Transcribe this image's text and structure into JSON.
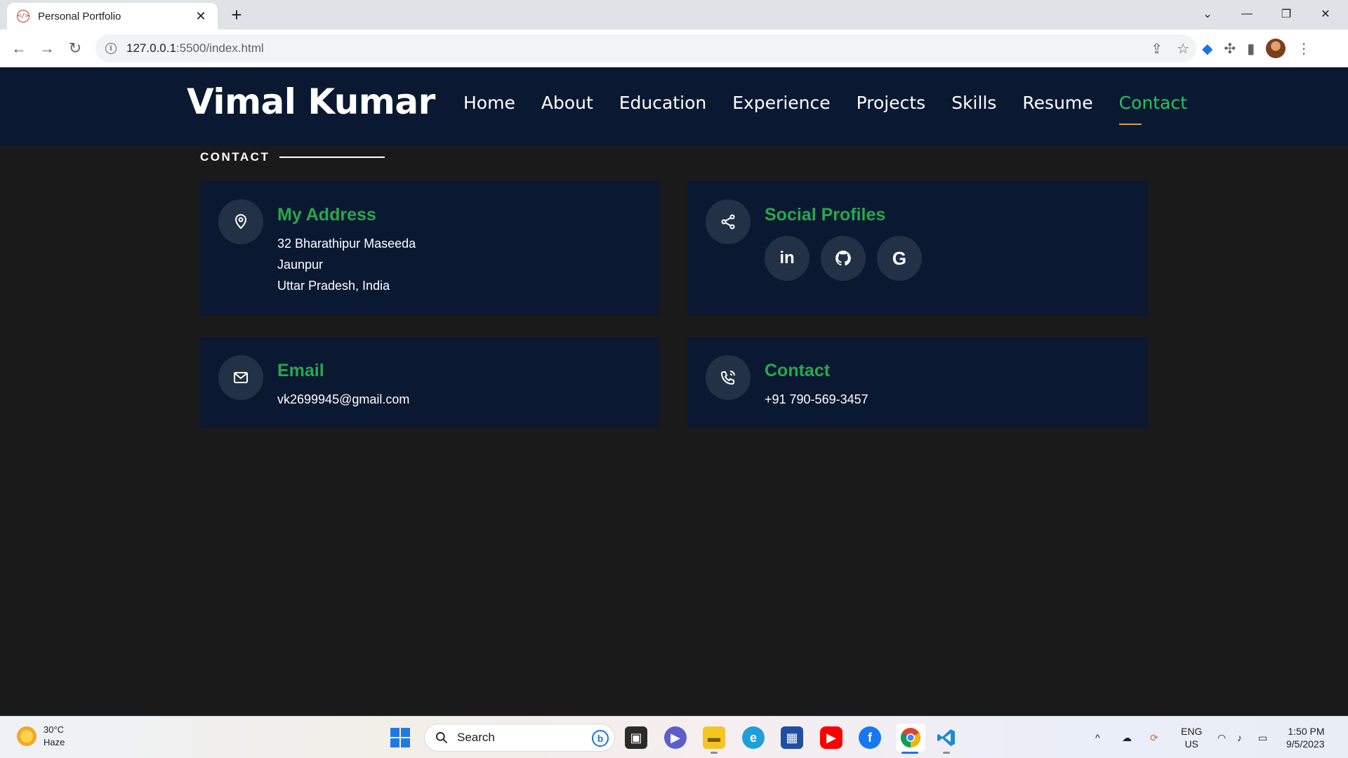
{
  "browser": {
    "tab_title": "Personal Portfolio",
    "url_host": "127.0.0.1",
    "url_rest": ":5500/index.html"
  },
  "site": {
    "brand": "Vimal Kumar",
    "nav": [
      {
        "label": "Home",
        "active": false
      },
      {
        "label": "About",
        "active": false
      },
      {
        "label": "Education",
        "active": false
      },
      {
        "label": "Experience",
        "active": false
      },
      {
        "label": "Projects",
        "active": false
      },
      {
        "label": "Skills",
        "active": false
      },
      {
        "label": "Resume",
        "active": false
      },
      {
        "label": "Contact",
        "active": true
      }
    ],
    "section_title": "CONTACT",
    "cards": {
      "address": {
        "title": "My Address",
        "lines": [
          "32 Bharathipur Maseeda",
          "Jaunpur",
          "Uttar Pradesh, India"
        ]
      },
      "social": {
        "title": "Social Profiles",
        "profiles": [
          {
            "icon": "linkedin-icon",
            "glyph": "in"
          },
          {
            "icon": "github-icon",
            "glyph": ""
          },
          {
            "icon": "google-icon",
            "glyph": "G"
          }
        ]
      },
      "email": {
        "title": "Email",
        "value": "vk2699945@gmail.com"
      },
      "contact": {
        "title": "Contact",
        "value": "+91 790-569-3457"
      }
    },
    "colors": {
      "header_bg": "#0a1931",
      "page_bg": "#1a1a1a",
      "accent_green": "#27a84e",
      "active_underline": "#d6a33a"
    }
  },
  "taskbar": {
    "weather_temp": "30°C",
    "weather_desc": "Haze",
    "search_label": "Search",
    "lang_top": "ENG",
    "lang_bottom": "US",
    "time": "1:50 PM",
    "date": "9/5/2023"
  }
}
